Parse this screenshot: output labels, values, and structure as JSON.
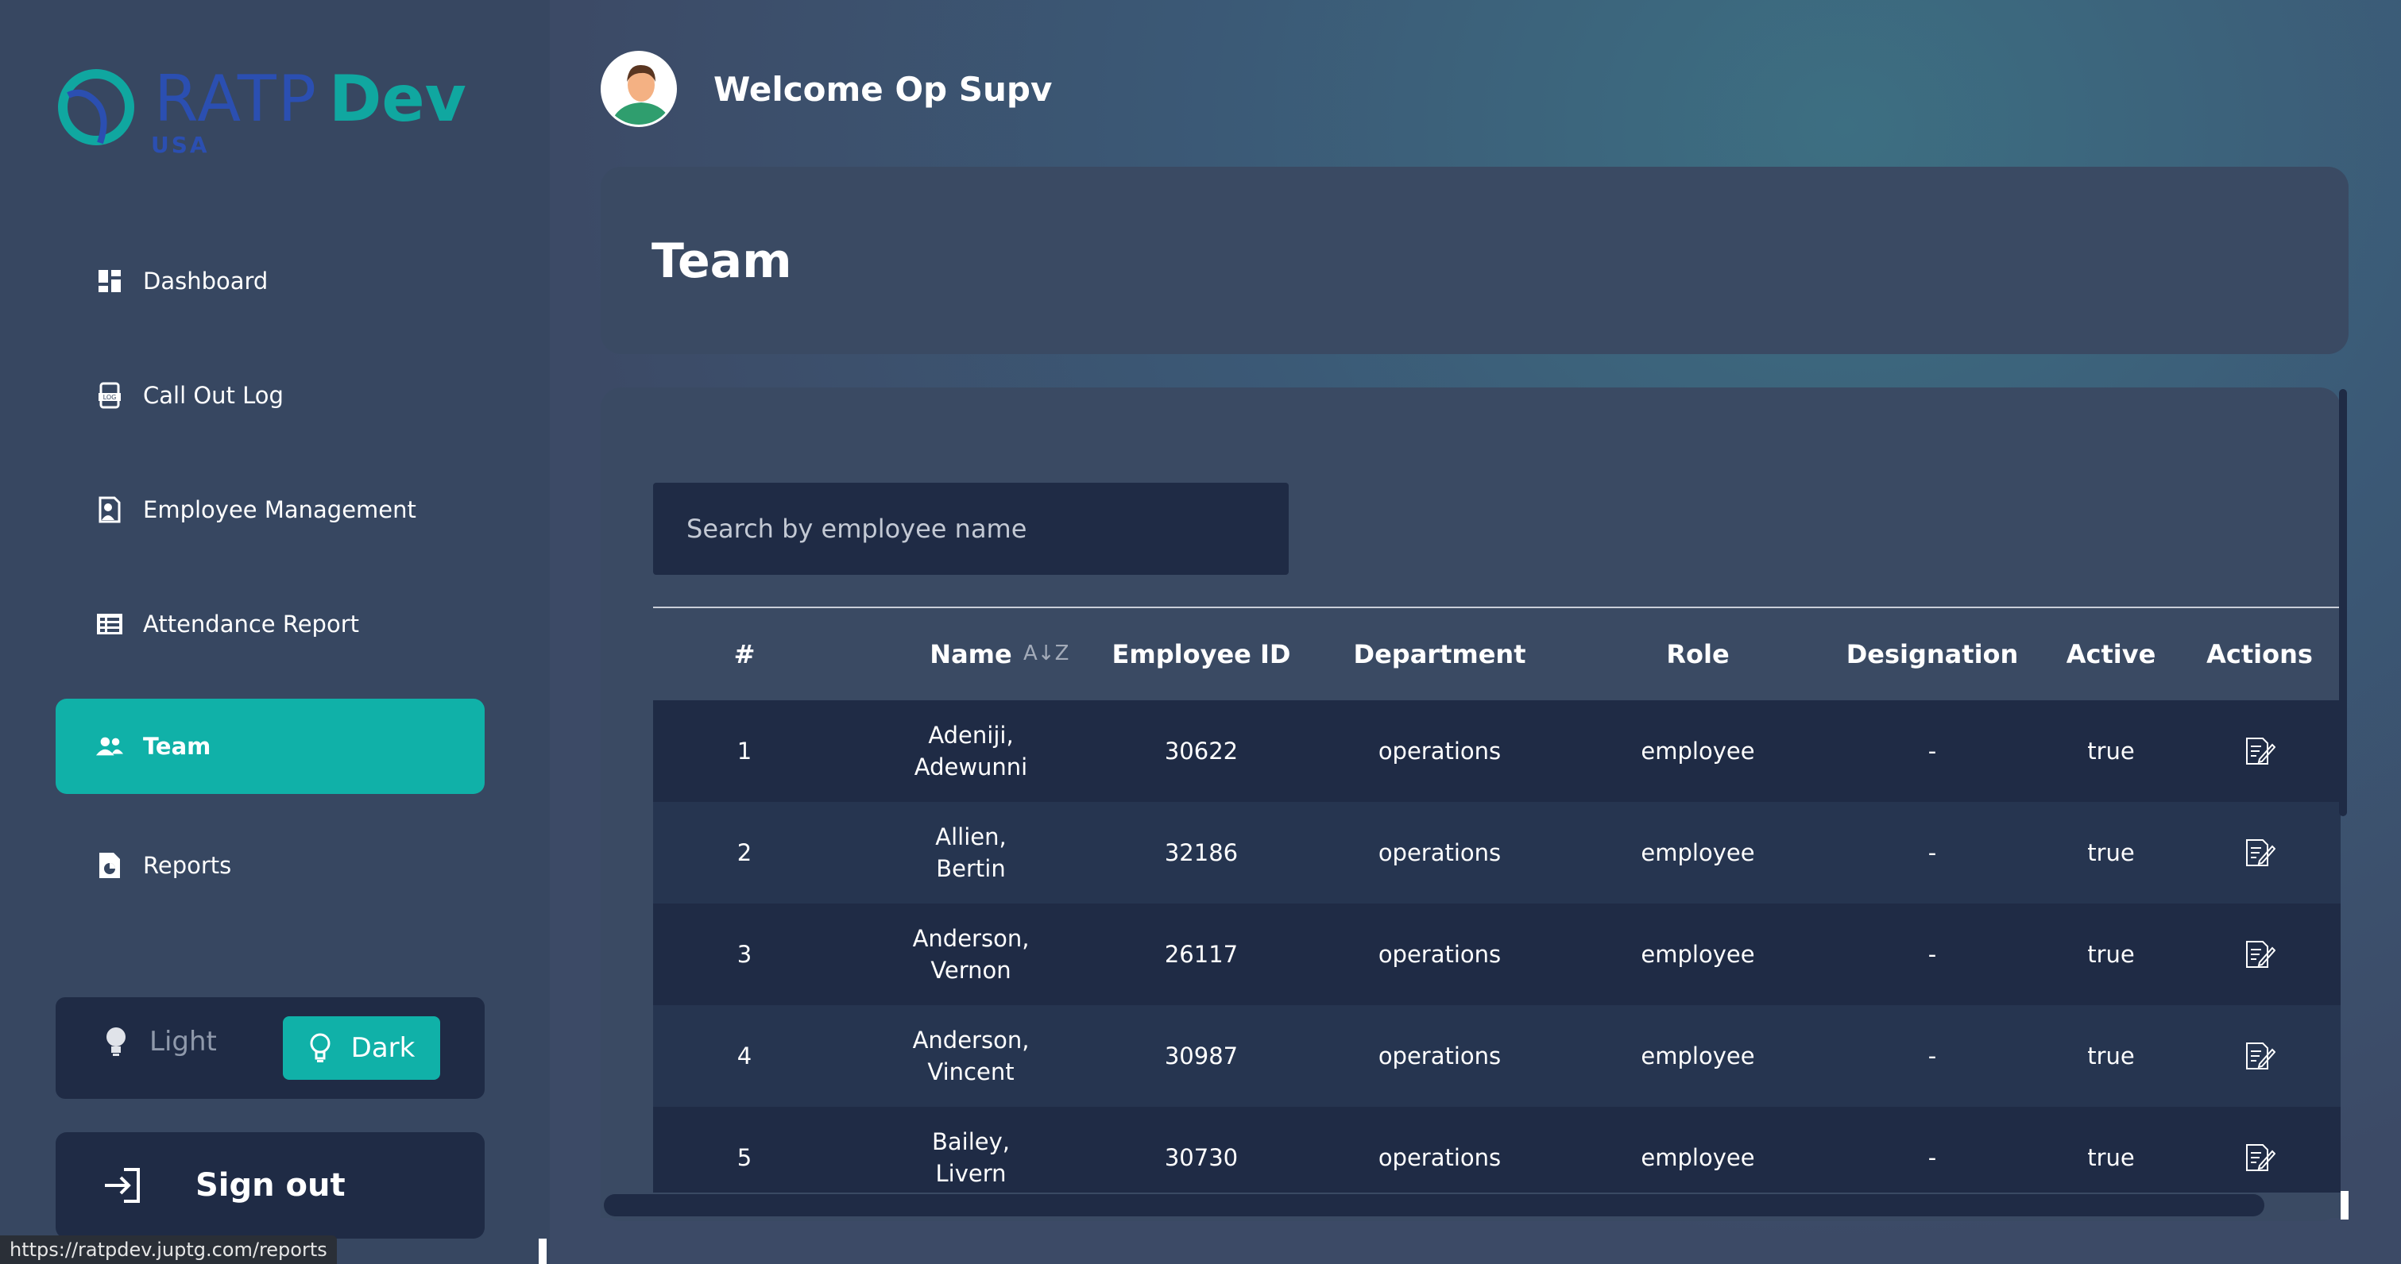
{
  "logo": {
    "brand_1": "RATP",
    "brand_2": "Dev",
    "region": "USA"
  },
  "sidebar": {
    "items": [
      {
        "label": "Dashboard",
        "icon": "dashboard-icon"
      },
      {
        "label": "Call Out Log",
        "icon": "log-icon"
      },
      {
        "label": "Employee Management",
        "icon": "employee-management-icon"
      },
      {
        "label": "Attendance Report",
        "icon": "attendance-report-icon"
      },
      {
        "label": "Team",
        "icon": "team-icon",
        "active": true
      },
      {
        "label": "Reports",
        "icon": "reports-icon"
      }
    ],
    "theme": {
      "light_label": "Light",
      "dark_label": "Dark",
      "selected": "Dark"
    },
    "signout_label": "Sign out"
  },
  "header": {
    "welcome": "Welcome Op Supv"
  },
  "page": {
    "title": "Team"
  },
  "search": {
    "placeholder": "Search by employee name",
    "value": ""
  },
  "table": {
    "columns": [
      "#",
      "Name",
      "Employee ID",
      "Department",
      "Role",
      "Designation",
      "Active",
      "Actions"
    ],
    "rows": [
      {
        "num": "1",
        "name_last": "Adeniji,",
        "name_first": "Adewunni",
        "employee_id": "30622",
        "department": "operations",
        "role": "employee",
        "designation": "-",
        "active": "true"
      },
      {
        "num": "2",
        "name_last": "Allien,",
        "name_first": "Bertin",
        "employee_id": "32186",
        "department": "operations",
        "role": "employee",
        "designation": "-",
        "active": "true"
      },
      {
        "num": "3",
        "name_last": "Anderson,",
        "name_first": "Vernon",
        "employee_id": "26117",
        "department": "operations",
        "role": "employee",
        "designation": "-",
        "active": "true"
      },
      {
        "num": "4",
        "name_last": "Anderson,",
        "name_first": "Vincent",
        "employee_id": "30987",
        "department": "operations",
        "role": "employee",
        "designation": "-",
        "active": "true"
      },
      {
        "num": "5",
        "name_last": "Bailey,",
        "name_first": "Livern",
        "employee_id": "30730",
        "department": "operations",
        "role": "employee",
        "designation": "-",
        "active": "true"
      }
    ]
  },
  "statusbar": {
    "url": "https://ratpdev.juptg.com/reports"
  },
  "colors": {
    "accent": "#10b1a8",
    "sidebar_bg": "#374761",
    "card_bg": "#3a4a63",
    "row_dark": "#1f2b45",
    "logo_blue": "#2b4fb1"
  }
}
